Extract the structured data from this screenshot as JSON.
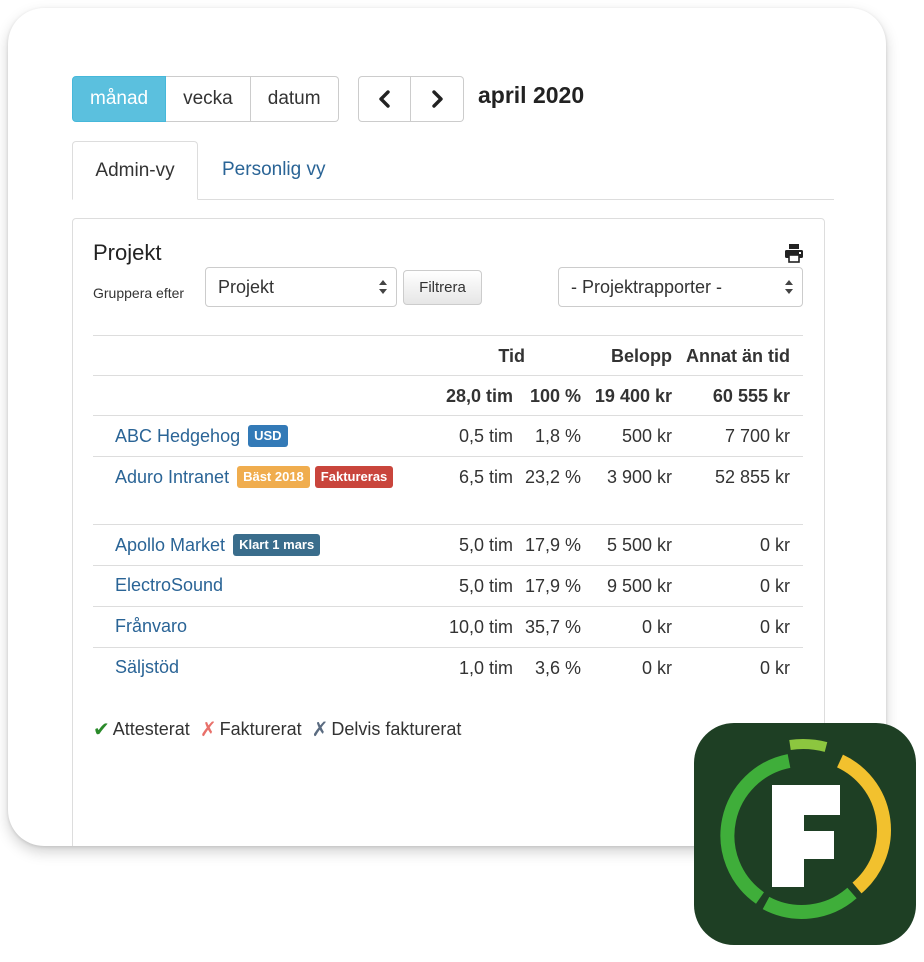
{
  "view_modes": [
    {
      "label": "månad",
      "active": true
    },
    {
      "label": "vecka",
      "active": false
    },
    {
      "label": "datum",
      "active": false
    }
  ],
  "period": "april 2020",
  "tabs": [
    {
      "label": "Admin-vy",
      "active": true
    },
    {
      "label": "Personlig vy",
      "active": false
    }
  ],
  "panel": {
    "title": "Projekt",
    "group_by_label": "Gruppera efter",
    "group_by_value": "Projekt",
    "filter_label": "Filtrera",
    "reports_value": "- Projektrapporter -"
  },
  "table": {
    "headers": {
      "tid": "Tid",
      "belopp": "Belopp",
      "annat": "Annat än tid"
    },
    "totals": {
      "tim": "28,0 tim",
      "pct": "100 %",
      "belopp": "19 400 kr",
      "annat": "60 555 kr"
    },
    "rows": [
      {
        "project": "ABC Hedgehog",
        "badges": [
          {
            "text": "USD",
            "color": "#337ab7"
          }
        ],
        "tim": "0,5 tim",
        "pct": "1,8 %",
        "belopp": "500 kr",
        "annat": "7 700 kr"
      },
      {
        "project": "Aduro Intranet",
        "badges": [
          {
            "text": "Bäst 2018",
            "color": "#f0ad4e"
          },
          {
            "text": "Faktureras",
            "color": "#c9453c"
          }
        ],
        "tim": "6,5 tim",
        "pct": "23,2 %",
        "belopp": "3 900 kr",
        "annat": "52 855 kr"
      },
      {
        "project": "Apollo Market",
        "badges": [
          {
            "text": "Klart 1 mars",
            "color": "#3a6d8c"
          }
        ],
        "tim": "5,0 tim",
        "pct": "17,9 %",
        "belopp": "5 500 kr",
        "annat": "0 kr"
      },
      {
        "project": "ElectroSound",
        "badges": [],
        "tim": "5,0 tim",
        "pct": "17,9 %",
        "belopp": "9 500 kr",
        "annat": "0 kr"
      },
      {
        "project": "Frånvaro",
        "badges": [],
        "tim": "10,0 tim",
        "pct": "35,7 %",
        "belopp": "0 kr",
        "annat": "0 kr"
      },
      {
        "project": "Säljstöd",
        "badges": [],
        "tim": "1,0 tim",
        "pct": "3,6 %",
        "belopp": "0 kr",
        "annat": "0 kr"
      }
    ]
  },
  "legend": [
    {
      "mark": "✔",
      "label": "Attesterat",
      "color": "#2a8a2a"
    },
    {
      "mark": "✗",
      "label": "Fakturerat",
      "color": "#e8706a"
    },
    {
      "mark": "✗",
      "label": "Delvis fakturerat",
      "color": "#5a6b80"
    }
  ],
  "icons": {
    "prev": "chevron-left-icon",
    "next": "chevron-right-icon",
    "print": "printer-icon",
    "app": "app-logo-icon"
  },
  "colors": {
    "active_button": "#5bc0de",
    "link": "#2a6496",
    "app_bg": "#1e3f24",
    "app_ring_green": "#3fae3a",
    "app_ring_yellow": "#f2c12e"
  }
}
